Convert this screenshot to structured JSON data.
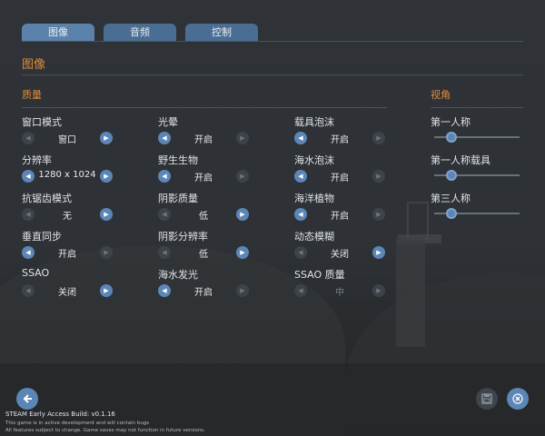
{
  "tabs": [
    {
      "label": "图像",
      "active": true
    },
    {
      "label": "音频",
      "active": false
    },
    {
      "label": "控制",
      "active": false
    }
  ],
  "page_title": "图像",
  "sections": {
    "quality": "质量",
    "view": "视角"
  },
  "settings": [
    {
      "label": "窗口模式",
      "value": "窗口",
      "left_enabled": false,
      "right_enabled": true
    },
    {
      "label": "光晕",
      "value": "开启",
      "left_enabled": true,
      "right_enabled": false
    },
    {
      "label": "载具泡沫",
      "value": "开启",
      "left_enabled": true,
      "right_enabled": false
    },
    {
      "label": "分辨率",
      "value": "1280 x 1024",
      "left_enabled": true,
      "right_enabled": true
    },
    {
      "label": "野生生物",
      "value": "开启",
      "left_enabled": true,
      "right_enabled": false
    },
    {
      "label": "海水泡沫",
      "value": "开启",
      "left_enabled": true,
      "right_enabled": false
    },
    {
      "label": "抗锯齿模式",
      "value": "无",
      "left_enabled": false,
      "right_enabled": true
    },
    {
      "label": "阴影质量",
      "value": "低",
      "left_enabled": false,
      "right_enabled": true
    },
    {
      "label": "海洋植物",
      "value": "开启",
      "left_enabled": true,
      "right_enabled": false
    },
    {
      "label": "垂直同步",
      "value": "开启",
      "left_enabled": true,
      "right_enabled": false
    },
    {
      "label": "阴影分辨率",
      "value": "低",
      "left_enabled": false,
      "right_enabled": true
    },
    {
      "label": "动态模糊",
      "value": "关闭",
      "left_enabled": false,
      "right_enabled": true
    },
    {
      "label": "SSAO",
      "value": "关闭",
      "left_enabled": false,
      "right_enabled": true
    },
    {
      "label": "海水发光",
      "value": "开启",
      "left_enabled": true,
      "right_enabled": false
    },
    {
      "label": "SSAO 质量",
      "value": "中",
      "left_enabled": false,
      "right_enabled": false
    }
  ],
  "view": [
    {
      "label": "第一人称",
      "level": 0.2
    },
    {
      "label": "第一人称载具",
      "level": 0.2
    },
    {
      "label": "第三人称",
      "level": 0.2
    }
  ],
  "icons": {
    "back": "back-arrow-icon",
    "save": "save-icon",
    "close": "close-icon",
    "left": "arrow-left-icon",
    "right": "arrow-right-icon"
  },
  "colors": {
    "accent": "#e08a3c",
    "button": "#5b86b5",
    "tab": "#4a6e93"
  },
  "footer": {
    "build": "STEAM Early Access Build: v0.1.16",
    "note1": "This game is in active development and will contain bugs",
    "note2": "All features subject to change. Game saves may not function in future versions."
  }
}
